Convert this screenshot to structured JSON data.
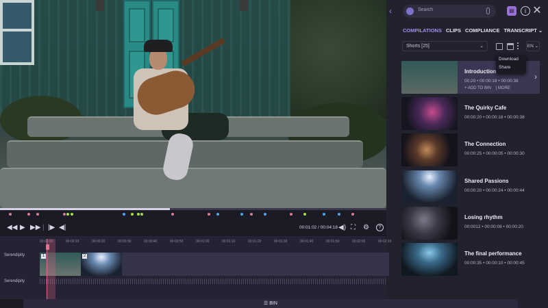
{
  "header": {
    "search_placeholder": "Search",
    "tabs": [
      "COMPILATIONS",
      "CLIPS",
      "COMPLIANCE",
      "TRANSCRIPT ⌄"
    ],
    "active_tab": "COMPILATIONS"
  },
  "filter": {
    "selected": "Shorts [25]",
    "language": "EN ⌄"
  },
  "menu": {
    "items": [
      "Download",
      "Share"
    ]
  },
  "clips": [
    {
      "title": "Introduction t",
      "time": "00:20  •  00:00:18  •  00:00:38",
      "add": "+ ADD TO BIN",
      "more": "| MORE"
    },
    {
      "title": "The Quirky Cafe",
      "time": "00:00:20  •  00:00:18  •  00:00:38"
    },
    {
      "title": "The Connection",
      "time": "00:00:25  •  00:00:05  •  00:00:30"
    },
    {
      "title": "Shared Passions",
      "time": "00:00:20  •  00:00:24  •  00:00:44"
    },
    {
      "title": "Losing rhythm",
      "time": "00:0012  •  00:00:08  •  00:00:20"
    },
    {
      "title": "The final performance",
      "time": "00:00:35  •  00:00:10  •  00:00:45"
    }
  ],
  "player": {
    "timecode": "00:01:02 / 00:04:18",
    "progress": 0.44
  },
  "markers": [
    {
      "pos": 0.027,
      "color": "#e07a90"
    },
    {
      "pos": 0.074,
      "color": "#e07a90"
    },
    {
      "pos": 0.098,
      "color": "#e07a90"
    },
    {
      "pos": 0.167,
      "color": "#e07a90"
    },
    {
      "pos": 0.176,
      "color": "#a6e04a"
    },
    {
      "pos": 0.186,
      "color": "#a6e04a"
    },
    {
      "pos": 0.321,
      "color": "#4aa6f0"
    },
    {
      "pos": 0.342,
      "color": "#a6e04a"
    },
    {
      "pos": 0.358,
      "color": "#a6e04a"
    },
    {
      "pos": 0.367,
      "color": "#a6e04a"
    },
    {
      "pos": 0.447,
      "color": "#e07a90"
    },
    {
      "pos": 0.541,
      "color": "#e07a90"
    },
    {
      "pos": 0.564,
      "color": "#4aa6f0"
    },
    {
      "pos": 0.626,
      "color": "#4aa6f0"
    },
    {
      "pos": 0.651,
      "color": "#e07a90"
    },
    {
      "pos": 0.687,
      "color": "#4aa6f0"
    },
    {
      "pos": 0.754,
      "color": "#e07a90"
    },
    {
      "pos": 0.789,
      "color": "#a6e04a"
    },
    {
      "pos": 0.839,
      "color": "#4aa6f0"
    },
    {
      "pos": 0.877,
      "color": "#4aa6f0"
    },
    {
      "pos": 0.913,
      "color": "#e07a90"
    }
  ],
  "timeline": {
    "ruler": [
      "00:00:00",
      "00:00:10",
      "00:00:20",
      "00:00:30",
      "00:00:40",
      "00:00:50",
      "00:01:00",
      "00:01:10",
      "00:01:20",
      "00:01:30",
      "00:01:40",
      "00:01:50",
      "00:02:00",
      "00:02:10"
    ],
    "tracks": [
      "Serendipity",
      "Serendipity"
    ],
    "clip_numbers": [
      "1",
      "2"
    ]
  },
  "bin_label": "☰ BIN"
}
